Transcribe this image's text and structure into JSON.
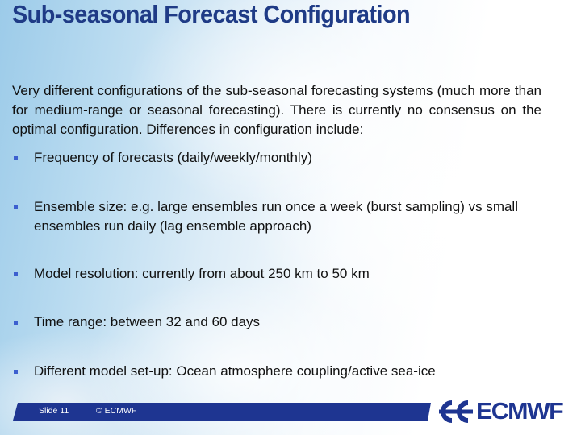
{
  "slide": {
    "title": "Sub-seasonal Forecast Configuration",
    "intro": "Very different configurations of the sub-seasonal forecasting systems (much more than for medium-range or seasonal forecasting). There is currently no consensus on the optimal configuration. Differences in configuration include:",
    "bullets": [
      "Frequency of forecasts (daily/weekly/monthly)",
      "Ensemble size: e.g. large ensembles run once a week (burst sampling) vs small ensembles run daily (lag ensemble approach)",
      "Model resolution: currently  from about 250 km to 50 km",
      "Time range: between 32 and 60 days",
      "Different model set-up: Ocean atmosphere coupling/active sea-ice"
    ]
  },
  "footer": {
    "slide_number": "Slide 11",
    "copyright": "© ECMWF",
    "logo_text": "ECMWF",
    "logo_icon": "ecmwf-logo-icon"
  },
  "colors": {
    "title": "#1f3b86",
    "bullet_marker": "#3c5fcf",
    "footer_bar": "#1e3591",
    "logo": "#1e3591"
  }
}
